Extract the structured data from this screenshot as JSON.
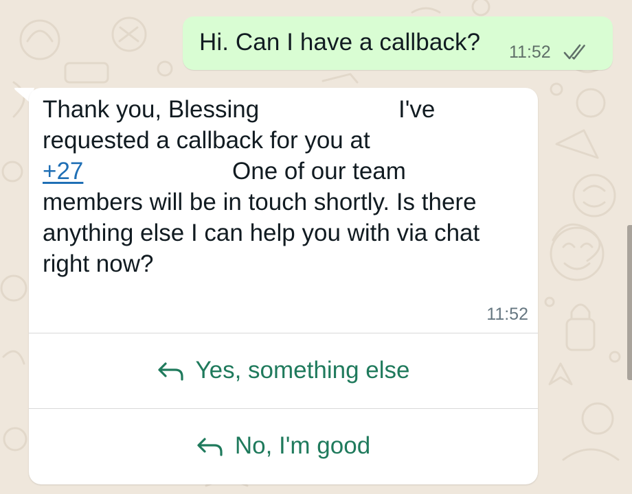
{
  "outgoing_message": {
    "text": "Hi. Can I have a callback?",
    "time": "11:52",
    "status_icon": "double-check-icon"
  },
  "incoming_message": {
    "line1_start": "Thank you, Blessing",
    "line1_end": "I've",
    "line2": "requested a callback for you at",
    "phone_prefix": "+27",
    "line3_end": "One of our team",
    "line4": "members will be in touch shortly. Is there",
    "line5": "anything else I can help you with via chat",
    "line6": "right now?",
    "time": "11:52"
  },
  "quick_replies": [
    {
      "label": "Yes, something else",
      "icon": "reply-arrow-icon"
    },
    {
      "label": "No, I'm good",
      "icon": "reply-arrow-icon"
    }
  ],
  "colors": {
    "background": "#efe7dc",
    "outgoing_bubble": "#d9fdd3",
    "incoming_bubble": "#ffffff",
    "button_text": "#1f7a5c",
    "link": "#1f6fb5",
    "tick": "#5f6f68"
  }
}
